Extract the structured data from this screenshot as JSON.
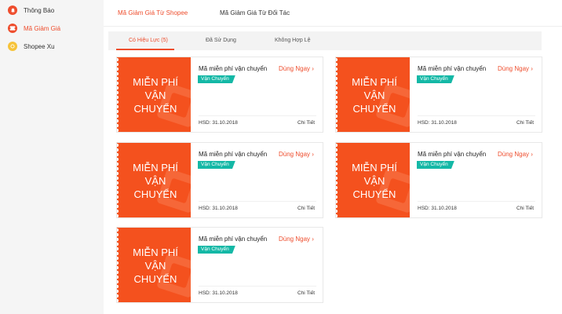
{
  "sidebar": {
    "items": [
      {
        "label": "Thông Báo",
        "icon": "bell-icon",
        "active": false
      },
      {
        "label": "Mã Giảm Giá",
        "icon": "voucher-icon",
        "active": true
      },
      {
        "label": "Shopee Xu",
        "icon": "coin-icon",
        "active": false
      }
    ]
  },
  "tabs": {
    "shopee": "Mã Giảm Giá Từ Shopee",
    "partner": "Mã Giảm Giá Từ Đối Tác"
  },
  "subtabs": {
    "valid": "Có Hiệu Lực (5)",
    "used": "Đã Sử Dụng",
    "invalid": "Không Hợp Lệ"
  },
  "vouchers": [
    {
      "banner": "MIỄN PHÍ\nVẬN\nCHUYỂN",
      "title": "Mã miễn phí vận chuyển",
      "use": "Dùng Ngay",
      "tag": "Vận Chuyển",
      "date": "HSD: 31.10.2018",
      "detail": "Chi Tiết"
    },
    {
      "banner": "MIỄN PHÍ\nVẬN\nCHUYỂN",
      "title": "Mã miễn phí vận chuyển",
      "use": "Dùng Ngay",
      "tag": "Vận Chuyển",
      "date": "HSD: 31.10.2018",
      "detail": "Chi Tiết"
    },
    {
      "banner": "MIỄN PHÍ\nVẬN\nCHUYỂN",
      "title": "Mã miễn phí vận chuyển",
      "use": "Dùng Ngay",
      "tag": "Vận Chuyển",
      "date": "HSD: 31.10.2018",
      "detail": "Chi Tiết"
    },
    {
      "banner": "MIỄN PHÍ\nVẬN\nCHUYỂN",
      "title": "Mã miễn phí vận chuyển",
      "use": "Dùng Ngay",
      "tag": "Vận Chuyển",
      "date": "HSD: 31.10.2018",
      "detail": "Chi Tiết"
    },
    {
      "banner": "MIỄN PHÍ\nVẬN\nCHUYỂN",
      "title": "Mã miễn phí vận chuyển",
      "use": "Dùng Ngay",
      "tag": "Vận Chuyển",
      "date": "HSD: 31.10.2018",
      "detail": "Chi Tiết"
    }
  ],
  "colors": {
    "accent": "#ee4d2d",
    "banner": "#f4511e",
    "tag": "#14b8a6",
    "coin": "#f6c33a"
  }
}
